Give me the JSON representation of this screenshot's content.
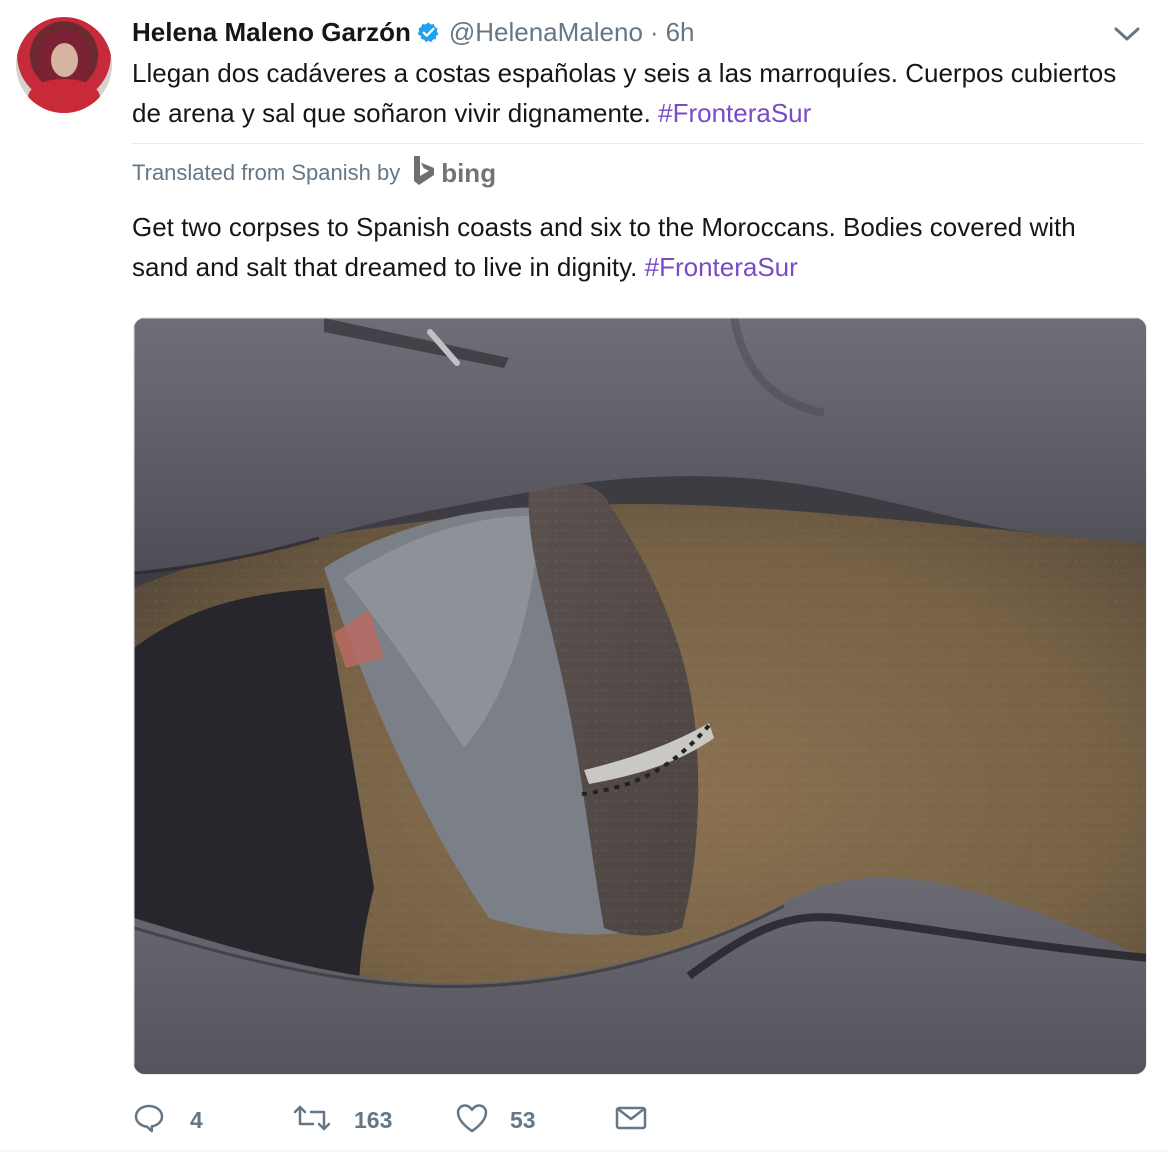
{
  "tweet": {
    "display_name": "Helena Maleno Garzón",
    "handle": "@HelenaMaleno",
    "dot": "·",
    "time": "6h",
    "original_text": "Llegan dos cadáveres a costas españolas y seis a las marroquíes. Cuerpos cubiertos de arena y sal que soñaron vivir dignamente.",
    "original_hashtag": "#FronteraSur",
    "translation_prefix": "Translated from Spanish by",
    "translation_provider": "bing",
    "translated_text": "Get two corpses to Spanish coasts and six to the Moroccans. Bodies covered with sand and salt that dreamed to live in dignity.",
    "translated_hashtag": "#FronteraSur",
    "reply_count": "4",
    "retweet_count": "163",
    "like_count": "53",
    "icons": {
      "verified": "verified-icon",
      "menu": "chevron-down-icon",
      "reply": "reply-icon",
      "retweet": "retweet-icon",
      "like": "heart-icon",
      "message": "mail-icon",
      "provider": "bing-icon"
    },
    "colors": {
      "hashtag": "#794bc4",
      "verified": "#1da1f2",
      "muted": "#657786"
    }
  }
}
